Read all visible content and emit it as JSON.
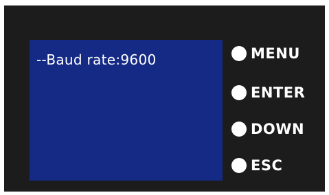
{
  "display": {
    "text": "--Baud rate:9600"
  },
  "buttons": {
    "menu": "MENU",
    "enter": "ENTER",
    "down": "DOWN",
    "esc": "ESC"
  },
  "colors": {
    "panel": "#1c1c1c",
    "lcd_background": "#142a85",
    "text": "#ffffff"
  }
}
